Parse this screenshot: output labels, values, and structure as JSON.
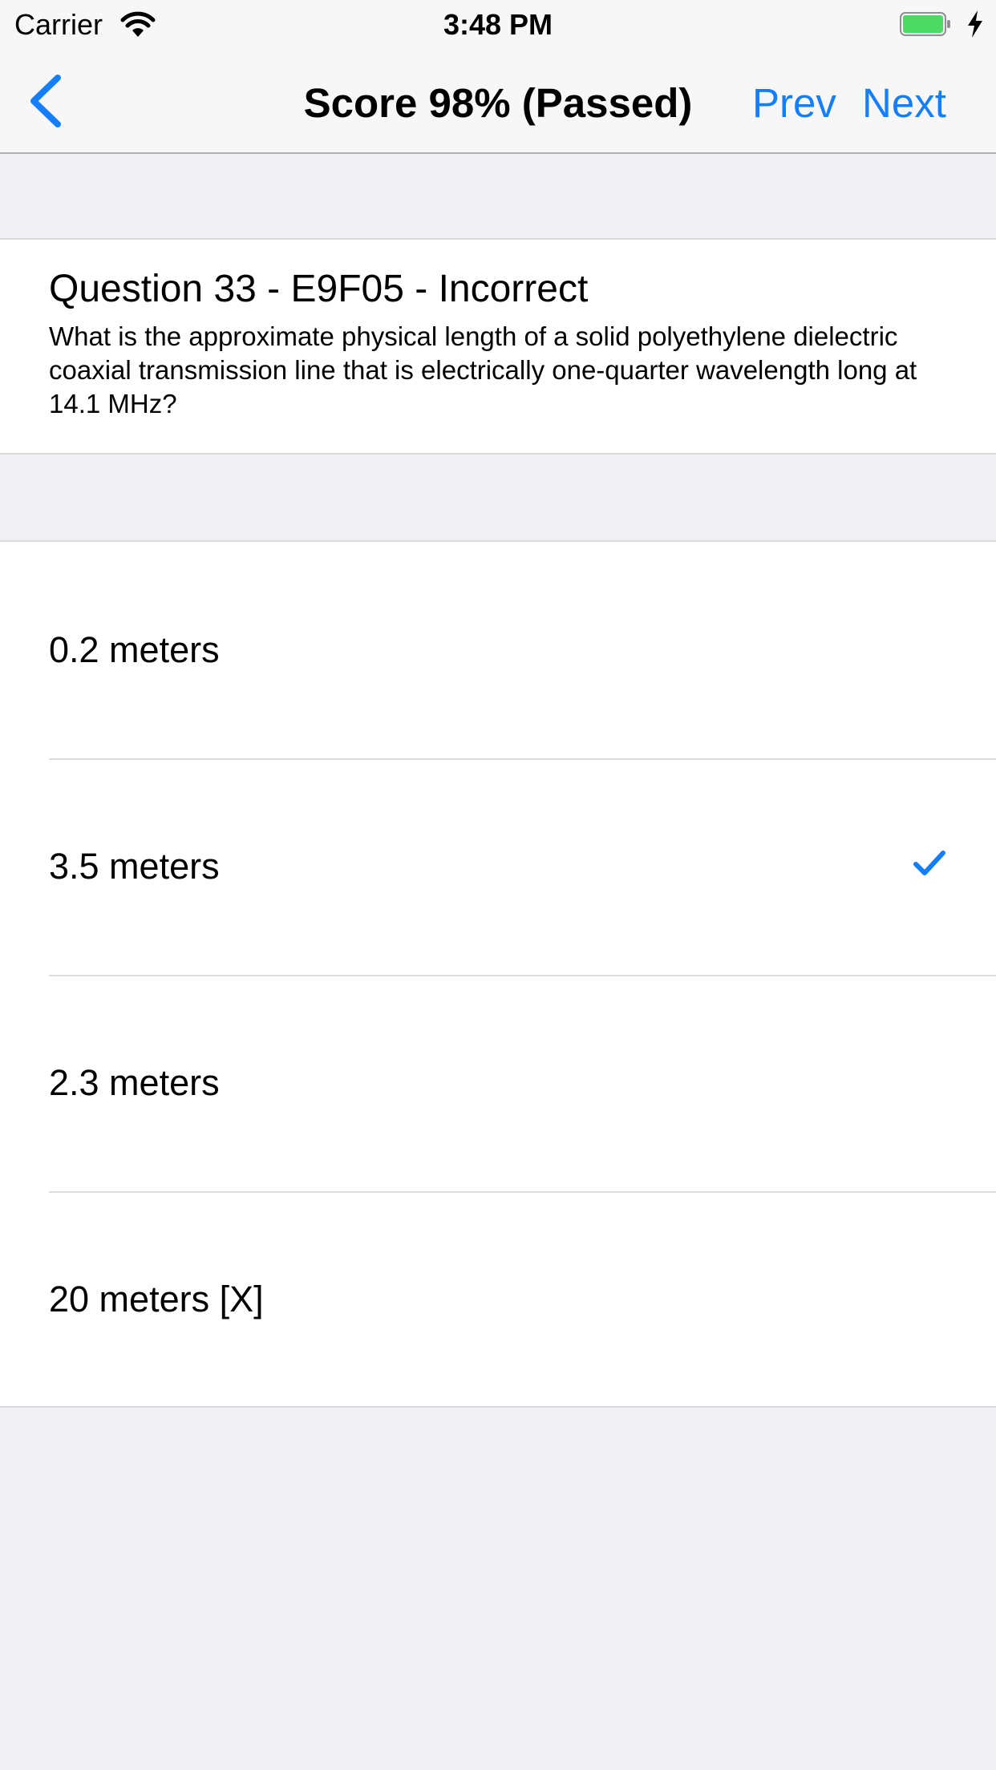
{
  "status_bar": {
    "carrier": "Carrier",
    "time": "3:48 PM",
    "wifi_icon": "wifi-icon",
    "battery_icon": "battery-icon",
    "battery_color": "#4cd964",
    "charging_icon": "bolt-icon"
  },
  "nav": {
    "title": "Score 98% (Passed)",
    "back_icon": "chevron-left-icon",
    "prev_label": "Prev",
    "next_label": "Next",
    "accent_color": "#157efb"
  },
  "question": {
    "heading": "Question 33 - E9F05 - Incorrect",
    "text": "What is the approximate physical length of a solid polyethylene dielectric coaxial transmission line that is electrically one-quarter wavelength long at 14.1 MHz?"
  },
  "answers": [
    {
      "label": "0.2 meters",
      "checked": false
    },
    {
      "label": "3.5 meters",
      "checked": true
    },
    {
      "label": "2.3 meters",
      "checked": false
    },
    {
      "label": "20 meters [X]",
      "checked": false
    }
  ],
  "checkmark_icon": "checkmark-icon"
}
